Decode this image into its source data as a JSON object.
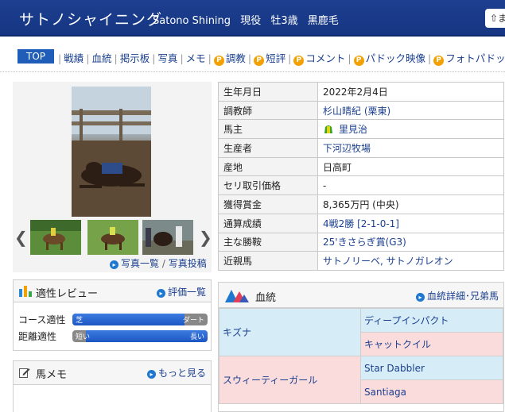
{
  "header": {
    "name_jp": "サトノシャイニング",
    "name_en": "Satono Shining",
    "status": "現役",
    "sex_age": "牡3歳",
    "coat": "黒鹿毛",
    "share_label": "⇧ま"
  },
  "nav": {
    "top": "TOP",
    "items": [
      {
        "label": "戦績",
        "premium": false
      },
      {
        "label": "血統",
        "premium": false
      },
      {
        "label": "掲示板",
        "premium": false
      },
      {
        "label": "写真",
        "premium": false
      },
      {
        "label": "メモ",
        "premium": false
      },
      {
        "label": "調教",
        "premium": true
      },
      {
        "label": "短評",
        "premium": true
      },
      {
        "label": "コメント",
        "premium": true
      },
      {
        "label": "パドック映像",
        "premium": true
      },
      {
        "label": "フォトパドック",
        "premium": true
      }
    ],
    "premium_mark": "P"
  },
  "photos": {
    "list_link": "写真一覧",
    "post_link": "写真投稿",
    "prev": "❮",
    "next": "❯"
  },
  "profile": [
    {
      "key": "生年月日",
      "value": "2022年2月4日",
      "link": false
    },
    {
      "key": "調教師",
      "value": "杉山晴紀 (栗東)",
      "link": true
    },
    {
      "key": "馬主",
      "value": "里見治",
      "link": true,
      "silks": true
    },
    {
      "key": "生産者",
      "value": "下河辺牧場",
      "link": true
    },
    {
      "key": "産地",
      "value": "日高町",
      "link": false
    },
    {
      "key": "セリ取引価格",
      "value": "-",
      "link": false
    },
    {
      "key": "獲得賞金",
      "value": "8,365万円 (中央)",
      "link": false
    },
    {
      "key": "通算成績",
      "value": "4戦2勝 [2-1-0-1]",
      "link": true
    },
    {
      "key": "主な勝鞍",
      "value": "25'きさらぎ賞(G3)",
      "link": true
    },
    {
      "key": "近親馬",
      "value": "サトノリーベ, サトノガレオン",
      "link": true
    }
  ],
  "aptitude": {
    "title": "適性レビュー",
    "link": "評価一覧",
    "rows": [
      {
        "label": "コース適性",
        "left": "芝",
        "right": "ダート",
        "value": 0.83
      },
      {
        "label": "距離適性",
        "left": "短い",
        "right": "長い",
        "value": 0.9
      }
    ]
  },
  "memo": {
    "title": "馬メモ",
    "link": "もっと見る"
  },
  "pedigree": {
    "title": "血統",
    "link": "血統詳細･兄弟馬",
    "sire": "キズナ",
    "sire_sire": "ディープインパクト",
    "sire_dam": "キャットクイル",
    "dam": "スウィーティーガール",
    "dam_sire": "Star Dabbler",
    "dam_dam": "Santiaga"
  },
  "colors": {
    "header": "#1d3f8f",
    "link": "#1a3f8f",
    "accent": "#f2a100",
    "sire_bg": "#d6ecf7",
    "dam_bg": "#fbdcdc"
  }
}
